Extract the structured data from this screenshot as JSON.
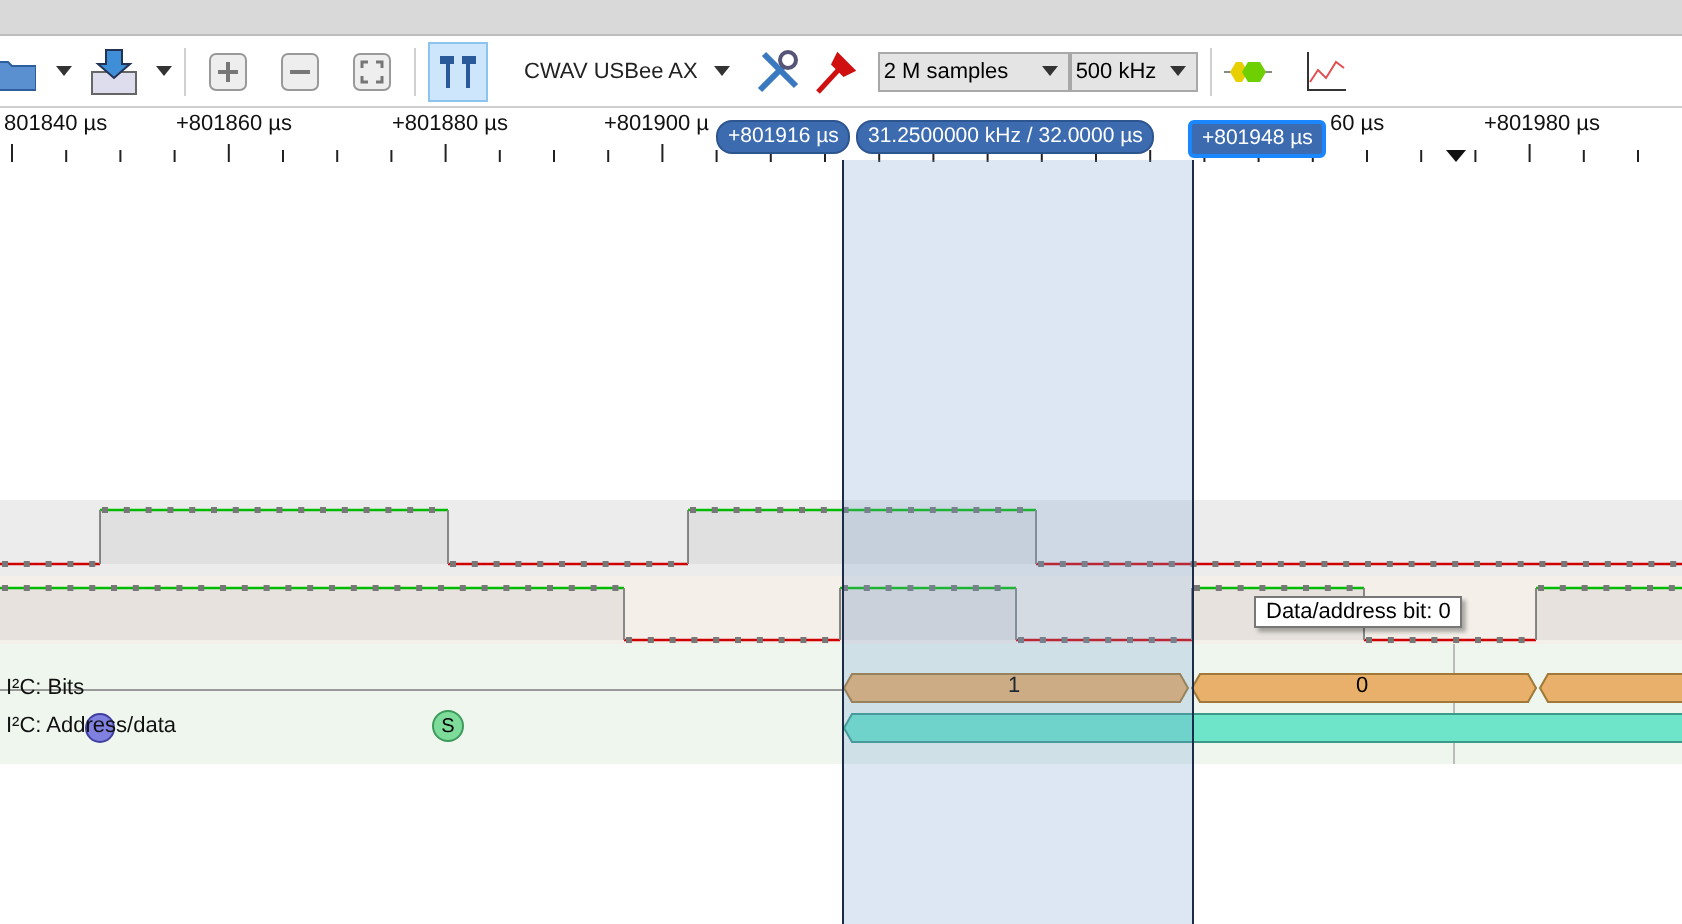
{
  "toolbar": {
    "device": "CWAV USBee AX",
    "samples": "2 M samples",
    "rate": "500 kHz",
    "cursor_tool_selected": true
  },
  "ruler": {
    "labels": [
      "801840 µs",
      "+801860 µs",
      "+801880 µs",
      "+801900 µ",
      "60 µs",
      "+801980 µs"
    ]
  },
  "markers": [
    {
      "text": "+801916 µs",
      "selected": false
    },
    {
      "text": "31.2500000 kHz / 32.0000 µs",
      "selected": false
    },
    {
      "text": "+801948 µs",
      "selected": true
    }
  ],
  "decoders": [
    {
      "label": "I²C: Bits",
      "segments": [
        "1",
        "0"
      ]
    },
    {
      "label": "I²C: Address/data",
      "event": "S"
    }
  ],
  "tooltip": "Data/address bit: 0"
}
